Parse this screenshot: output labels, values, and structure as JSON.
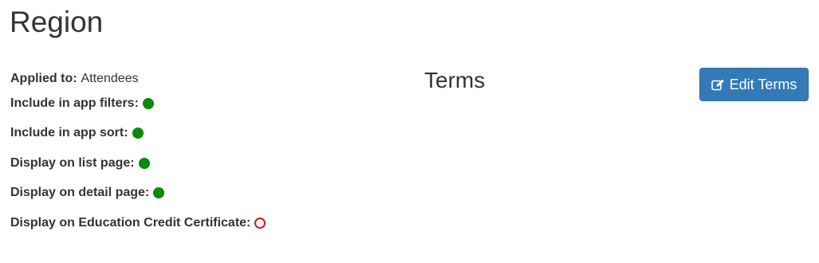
{
  "page": {
    "title": "Region"
  },
  "properties": [
    {
      "label": "Applied to:",
      "value": "Attendees"
    },
    {
      "label": "Include in app filters:",
      "status": "enabled"
    },
    {
      "label": "Include in app sort:",
      "status": "enabled"
    },
    {
      "label": "Display on list page:",
      "status": "enabled"
    },
    {
      "label": "Display on detail page:",
      "status": "enabled"
    },
    {
      "label": "Display on Education Credit Certificate:",
      "status": "disabled"
    }
  ],
  "terms": {
    "title": "Terms",
    "edit_button_label": "Edit Terms",
    "edit_icon": "edit-icon"
  },
  "colors": {
    "enabled": "#0a8a0a",
    "disabled": "#e8121b",
    "primary_button": "#337ab7"
  }
}
